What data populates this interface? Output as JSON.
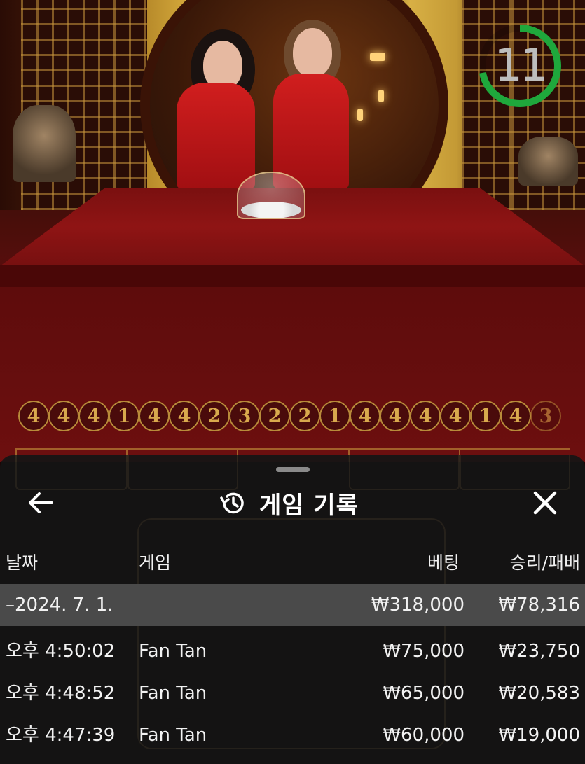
{
  "timer": {
    "seconds": "11",
    "progress": 0.72,
    "ring_color": "#1fa83c"
  },
  "bead_history": [
    "4",
    "4",
    "4",
    "1",
    "4",
    "4",
    "2",
    "3",
    "2",
    "2",
    "1",
    "4",
    "4",
    "4",
    "4",
    "1",
    "4",
    "3"
  ],
  "sheet": {
    "title": "게임 기록",
    "icons": {
      "back": "arrow-left-icon",
      "history": "history-icon",
      "close": "close-icon"
    },
    "columns": {
      "date": "날짜",
      "game": "게임",
      "bet": "베팅",
      "result": "승리/패배"
    },
    "summary": {
      "date": "–2024. 7. 1.",
      "bet": "₩318,000",
      "result": "₩78,316"
    },
    "rows": [
      {
        "time": "오후 4:50:02",
        "game": "Fan Tan",
        "bet": "₩75,000",
        "result": "₩23,750"
      },
      {
        "time": "오후 4:48:52",
        "game": "Fan Tan",
        "bet": "₩65,000",
        "result": "₩20,583"
      },
      {
        "time": "오후 4:47:39",
        "game": "Fan Tan",
        "bet": "₩60,000",
        "result": "₩19,000"
      }
    ]
  }
}
